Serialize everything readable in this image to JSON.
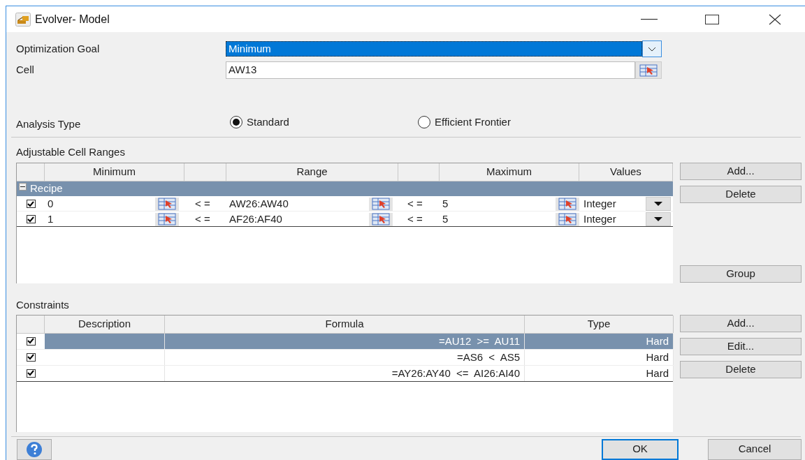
{
  "window": {
    "title": "Evolver- Model"
  },
  "goal": {
    "label": "Optimization Goal",
    "value": "Minimum"
  },
  "cell": {
    "label": "Cell",
    "value": "AW13"
  },
  "analysis": {
    "label": "Analysis Type",
    "options": [
      {
        "label": "Standard",
        "selected": true
      },
      {
        "label": "Efficient Frontier",
        "selected": false
      }
    ]
  },
  "adjustable": {
    "title": "Adjustable Cell Ranges",
    "columns": [
      "Minimum",
      "Range",
      "Maximum",
      "Values"
    ],
    "group": {
      "label": "Recipe",
      "expanded": true
    },
    "rows": [
      {
        "checked": true,
        "minimum": "0",
        "op1": "< =",
        "range": "AW26:AW40",
        "op2": "< =",
        "maximum": "5",
        "values": "Integer"
      },
      {
        "checked": true,
        "minimum": "1",
        "op1": "< =",
        "range": "AF26:AF40",
        "op2": "< =",
        "maximum": "5",
        "values": "Integer"
      }
    ],
    "buttons": [
      "Add...",
      "Delete",
      "Group"
    ]
  },
  "constraints": {
    "title": "Constraints",
    "columns": [
      "Description",
      "Formula",
      "Type"
    ],
    "rows": [
      {
        "checked": true,
        "selected": true,
        "formula": "=AU12 >= AU11",
        "type": "Hard"
      },
      {
        "checked": true,
        "selected": false,
        "formula": "=AS6 < AS5",
        "type": "Hard"
      },
      {
        "checked": true,
        "selected": false,
        "formula": "=AY26:AY40 <= AI26:AI40",
        "type": "Hard"
      }
    ],
    "buttons": [
      "Add...",
      "Edit...",
      "Delete"
    ]
  },
  "footer": {
    "buttons": [
      "OK",
      "Cancel"
    ]
  }
}
